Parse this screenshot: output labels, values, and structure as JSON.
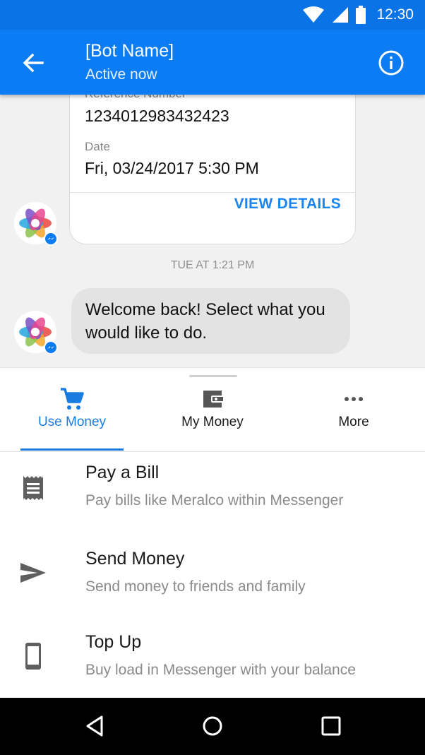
{
  "status_bar": {
    "time": "12:30"
  },
  "header": {
    "title": "[Bot Name]",
    "subtitle": "Active now"
  },
  "receipt": {
    "reference_label": "Reference Number",
    "reference_value": "1234012983432423",
    "date_label": "Date",
    "date_value": "Fri, 03/24/2017 5:30 PM",
    "action": "VIEW DETAILS"
  },
  "timestamp": "TUE AT 1:21 PM",
  "message": "Welcome back! Select what you would like to do.",
  "tabs": [
    {
      "label": "Use Money",
      "icon": "cart-icon",
      "active": true
    },
    {
      "label": "My Money",
      "icon": "wallet-icon",
      "active": false
    },
    {
      "label": "More",
      "icon": "more-icon",
      "active": false
    }
  ],
  "menu": [
    {
      "title": "Pay a Bill",
      "subtitle": "Pay bills like Meralco within Messenger",
      "icon": "receipt-icon"
    },
    {
      "title": "Send Money",
      "subtitle": "Send money to friends and family",
      "icon": "send-icon"
    },
    {
      "title": "Top Up",
      "subtitle": "Buy load in Messenger with your balance",
      "icon": "phone-icon"
    }
  ],
  "colors": {
    "status_bar": "#0a73e6",
    "app_bar": "#0b7cf4",
    "accent": "#1a7ce0",
    "chat_background": "#f1f1f1",
    "bubble": "#e3e3e3"
  }
}
